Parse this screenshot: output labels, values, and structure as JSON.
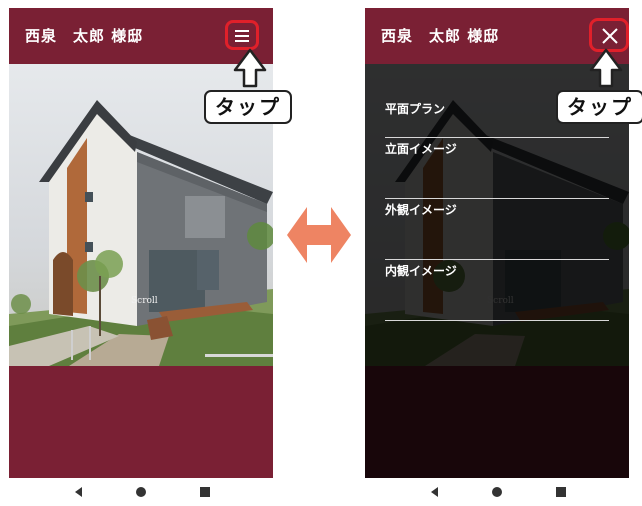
{
  "header": {
    "title": "西泉　太郎 様邸"
  },
  "scene": {
    "scroll_label": "Scroll"
  },
  "menu": {
    "items": [
      {
        "label": "平面プラン"
      },
      {
        "label": "立面イメージ"
      },
      {
        "label": "外観イメージ"
      },
      {
        "label": "内観イメージ"
      }
    ]
  },
  "annotations": {
    "tap_left": "タップ",
    "tap_right": "タップ"
  },
  "colors": {
    "brand": "#7a2034",
    "highlight": "#e0202a",
    "swap_arrow": "#ee8463"
  },
  "icons": {
    "menu": "hamburger-icon",
    "close": "close-icon",
    "swap": "double-arrow-icon"
  }
}
